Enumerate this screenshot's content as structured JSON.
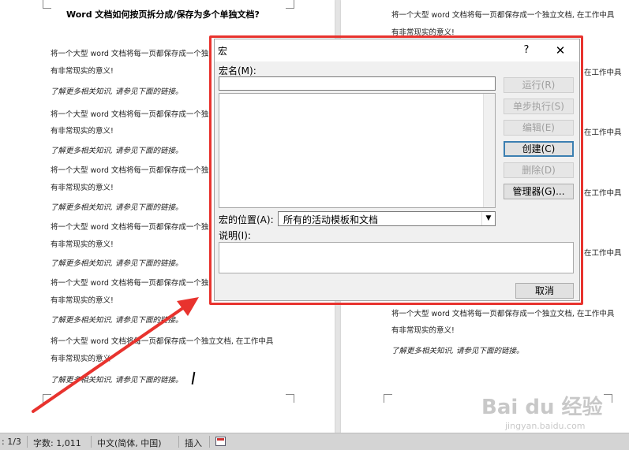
{
  "document": {
    "title": "Word 文档如何按页拆分成/保存为多个单独文档?",
    "para_line1": "将一个大型 word 文档将每一页都保存成一个独立文档, 在工作中具",
    "para_line1_short": "将一个大型 word 文档将每一页都保存成一个独",
    "para_line2": "有非常现实的意义!",
    "para_line3_cut": "有非常现实的意义",
    "para_line_right_a": "将一个大型 word 文档将每一页都保存成一个独立文档, 在工作中具",
    "link_text": "了解更多相关知识, 请参见下面的链接。",
    "right_fragment": "在工作中具"
  },
  "dialog": {
    "title": "宏",
    "help": "?",
    "close": "✕",
    "macro_name_label": "宏名(M):",
    "macro_name_value": "",
    "buttons": {
      "run": "运行(R)",
      "step": "单步执行(S)",
      "edit": "编辑(E)",
      "create": "创建(C)",
      "delete": "删除(D)",
      "organizer": "管理器(G)..."
    },
    "location_label": "宏的位置(A):",
    "location_value": "所有的活动模板和文档",
    "description_label": "说明(I):",
    "cancel": "取消"
  },
  "statusbar": {
    "page": ": 1/3",
    "words": "字数: 1,011",
    "language": "中文(简体, 中国)",
    "insert_mode": "插入"
  },
  "watermark": {
    "logo": "Bai du 经验",
    "url": "jingyan.baidu.com"
  },
  "colors": {
    "highlight": "#e8332e",
    "arrow": "#e8332e"
  }
}
